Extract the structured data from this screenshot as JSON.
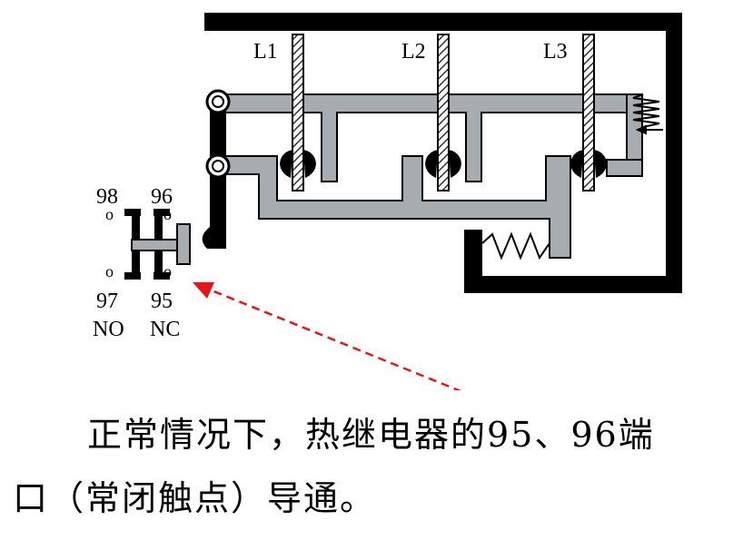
{
  "colors": {
    "frame": "#000000",
    "slider": "#a7acb1",
    "arrow": "#e8141c"
  },
  "diagram": {
    "phase_labels": [
      "L1",
      "L2",
      "L3"
    ],
    "terminals": {
      "t98": "98",
      "t96": "96",
      "t97": "97",
      "t95": "95",
      "no": "NO",
      "nc": "NC"
    },
    "contact_marks": {
      "m98": "o",
      "m97": "o",
      "m96": "o",
      "m95": "o"
    }
  },
  "caption": {
    "line1": "正常情况下，热继电器的95、96端",
    "line2": "口（常闭触点）导通。"
  }
}
